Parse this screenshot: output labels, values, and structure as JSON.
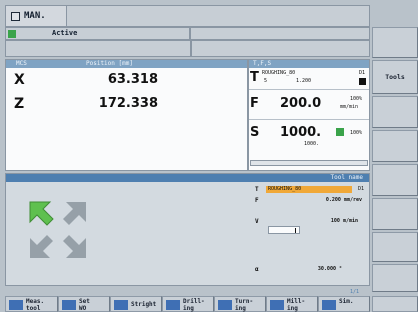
{
  "top": {
    "mode": "MAN.",
    "status": "Active"
  },
  "position": {
    "header_left": "MCS",
    "header_right": "Position [mm]",
    "axes": [
      {
        "name": "X",
        "value": "63.318"
      },
      {
        "name": "Z",
        "value": "172.338"
      }
    ]
  },
  "tfs": {
    "header": "T,F,S",
    "tool": "ROUGHING_80",
    "tool_no": "5",
    "tool_val": "1.200",
    "d": "D1",
    "f_value": "200.0",
    "f_pct": "100%",
    "f_unit": "mm/min",
    "s_value": "1000.",
    "s_sub": "1000.",
    "s_pct": "100%"
  },
  "lower": {
    "header_right": "Tool name",
    "tool_label": "T",
    "tool_name": "ROUGHING_80",
    "tool_d": "D1",
    "f_label": "F",
    "f_value": "0.200 mm/rev",
    "v_label": "V",
    "v_value": "100 m/min",
    "a_label": "α",
    "a_value": "30.000 °",
    "counter": "1/1"
  },
  "softkeys_right": [
    "",
    "",
    "Tools",
    "",
    "",
    "",
    "",
    ""
  ],
  "softkeys_bottom": [
    {
      "label": "Meas.",
      "sub": "tool"
    },
    {
      "label": "Set",
      "sub": "WO"
    },
    {
      "label": "Stright",
      "sub": ""
    },
    {
      "label": "Drill-",
      "sub": "ing"
    },
    {
      "label": "Turn-",
      "sub": "ing"
    },
    {
      "label": "Mill-",
      "sub": "ing"
    },
    {
      "label": "Sim.",
      "sub": ""
    }
  ],
  "colors": {
    "header_blue": "#7fa3c3",
    "tool_highlight": "#f0a838",
    "arrow_green": "#5fc04f",
    "status_green": "#3aa34a"
  }
}
